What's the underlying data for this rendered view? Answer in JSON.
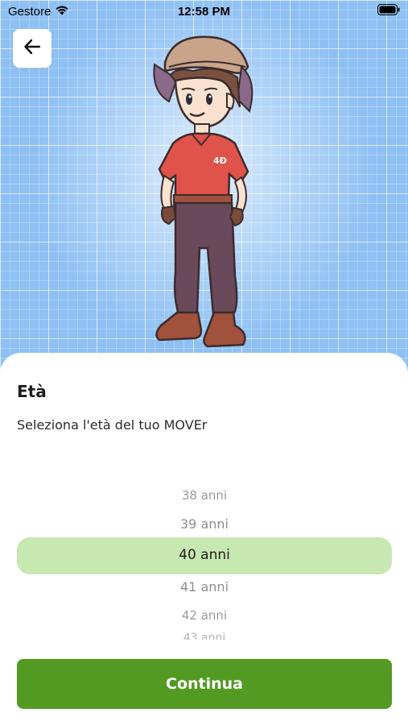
{
  "status_bar": {
    "carrier": "Gestore",
    "time": "12:58 PM",
    "wifi_icon": "wifi-icon",
    "battery_icon": "battery-icon"
  },
  "header": {
    "back_icon": "arrow-left-icon",
    "illustration": "mover-character-illustration"
  },
  "sheet": {
    "title": "Età",
    "subtitle": "Seleziona l'età del tuo MOVEr",
    "picker": {
      "items": [
        "38 anni",
        "39 anni",
        "40 anni",
        "41 anni",
        "42 anni",
        "43 anni"
      ],
      "selected": "40 anni"
    },
    "continue_label": "Continua"
  },
  "colors": {
    "background_blue": "#8ec0f4",
    "highlight": "#c8e8b2",
    "button_green": "#539a23"
  }
}
